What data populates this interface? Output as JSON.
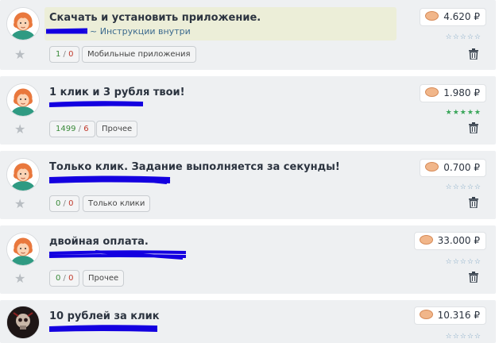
{
  "tasks": [
    {
      "title": "Скачать и установить приложение.",
      "subtitle": "~ Инструкции внутри",
      "likes": "1",
      "dislikes": "0",
      "category": "Мобильные приложения",
      "price": "4.620 ₽",
      "rating": "☆☆☆☆☆",
      "avatar": "redhead-avatar-icon"
    },
    {
      "title": "1 клик и 3 рубля твои!",
      "likes": "1499",
      "dislikes": "6",
      "category": "Прочее",
      "price": "1.980 ₽",
      "rating": "★★★★★",
      "avatar": "redhead-avatar-icon"
    },
    {
      "title": "Только клик. Задание выполняется за секунды!",
      "likes": "0",
      "dislikes": "0",
      "category": "Только клики",
      "price": "0.700 ₽",
      "rating": "☆☆☆☆☆",
      "avatar": "redhead-avatar-icon"
    },
    {
      "title": "двойная оплата.",
      "likes": "0",
      "dislikes": "0",
      "category": "Прочее",
      "price": "33.000 ₽",
      "rating": "☆☆☆☆☆",
      "avatar": "redhead-avatar-icon"
    },
    {
      "title": "10 рублей за клик",
      "price": "10.316 ₽",
      "rating": "☆☆☆☆☆",
      "avatar": "skull-avatar-icon"
    }
  ],
  "colors": {
    "card_bg": "#eef0f2",
    "highlight_bg": "#eceed8",
    "scribble": "#1400e0",
    "positive": "#3a8a3a",
    "negative": "#c0392b"
  }
}
